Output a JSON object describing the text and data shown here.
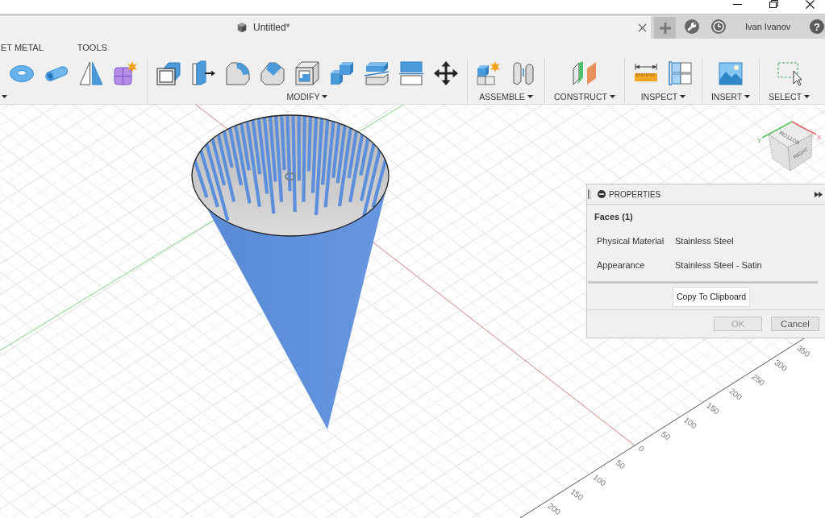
{
  "tab_bar": {
    "document_tab": {
      "title": "Untitled*",
      "selected": true
    },
    "user_name": "Ivan Ivanov",
    "help_label": "?"
  },
  "toolbar": {
    "tabs": [
      {
        "label": "ET METAL",
        "selected": false
      },
      {
        "label": "TOOLS",
        "selected": false
      }
    ],
    "groups": [
      {
        "label": "MODIFY"
      },
      {
        "label": "ASSEMBLE"
      },
      {
        "label": "CONSTRUCT"
      },
      {
        "label": "INSPECT"
      },
      {
        "label": "INSERT"
      },
      {
        "label": "SELECT"
      }
    ]
  },
  "viewport": {
    "axis_ticks": [
      "350",
      "300",
      "250",
      "200",
      "150",
      "100",
      "50",
      "0",
      "50",
      "100",
      "150",
      "200"
    ],
    "view_cube": {
      "faces": [
        "BOTTOM",
        "RIGHT"
      ],
      "axes": [
        "Y",
        "X"
      ]
    }
  },
  "properties_panel": {
    "title": "PROPERTIES",
    "section": "Faces (1)",
    "rows": [
      {
        "label": "Physical Material",
        "value": "Stainless Steel"
      },
      {
        "label": "Appearance",
        "value": "Stainless Steel - Satin"
      }
    ],
    "copy_button": "Copy To Clipboard",
    "buttons": [
      {
        "label": "OK",
        "disabled": true
      },
      {
        "label": "Cancel",
        "disabled": false
      }
    ]
  }
}
